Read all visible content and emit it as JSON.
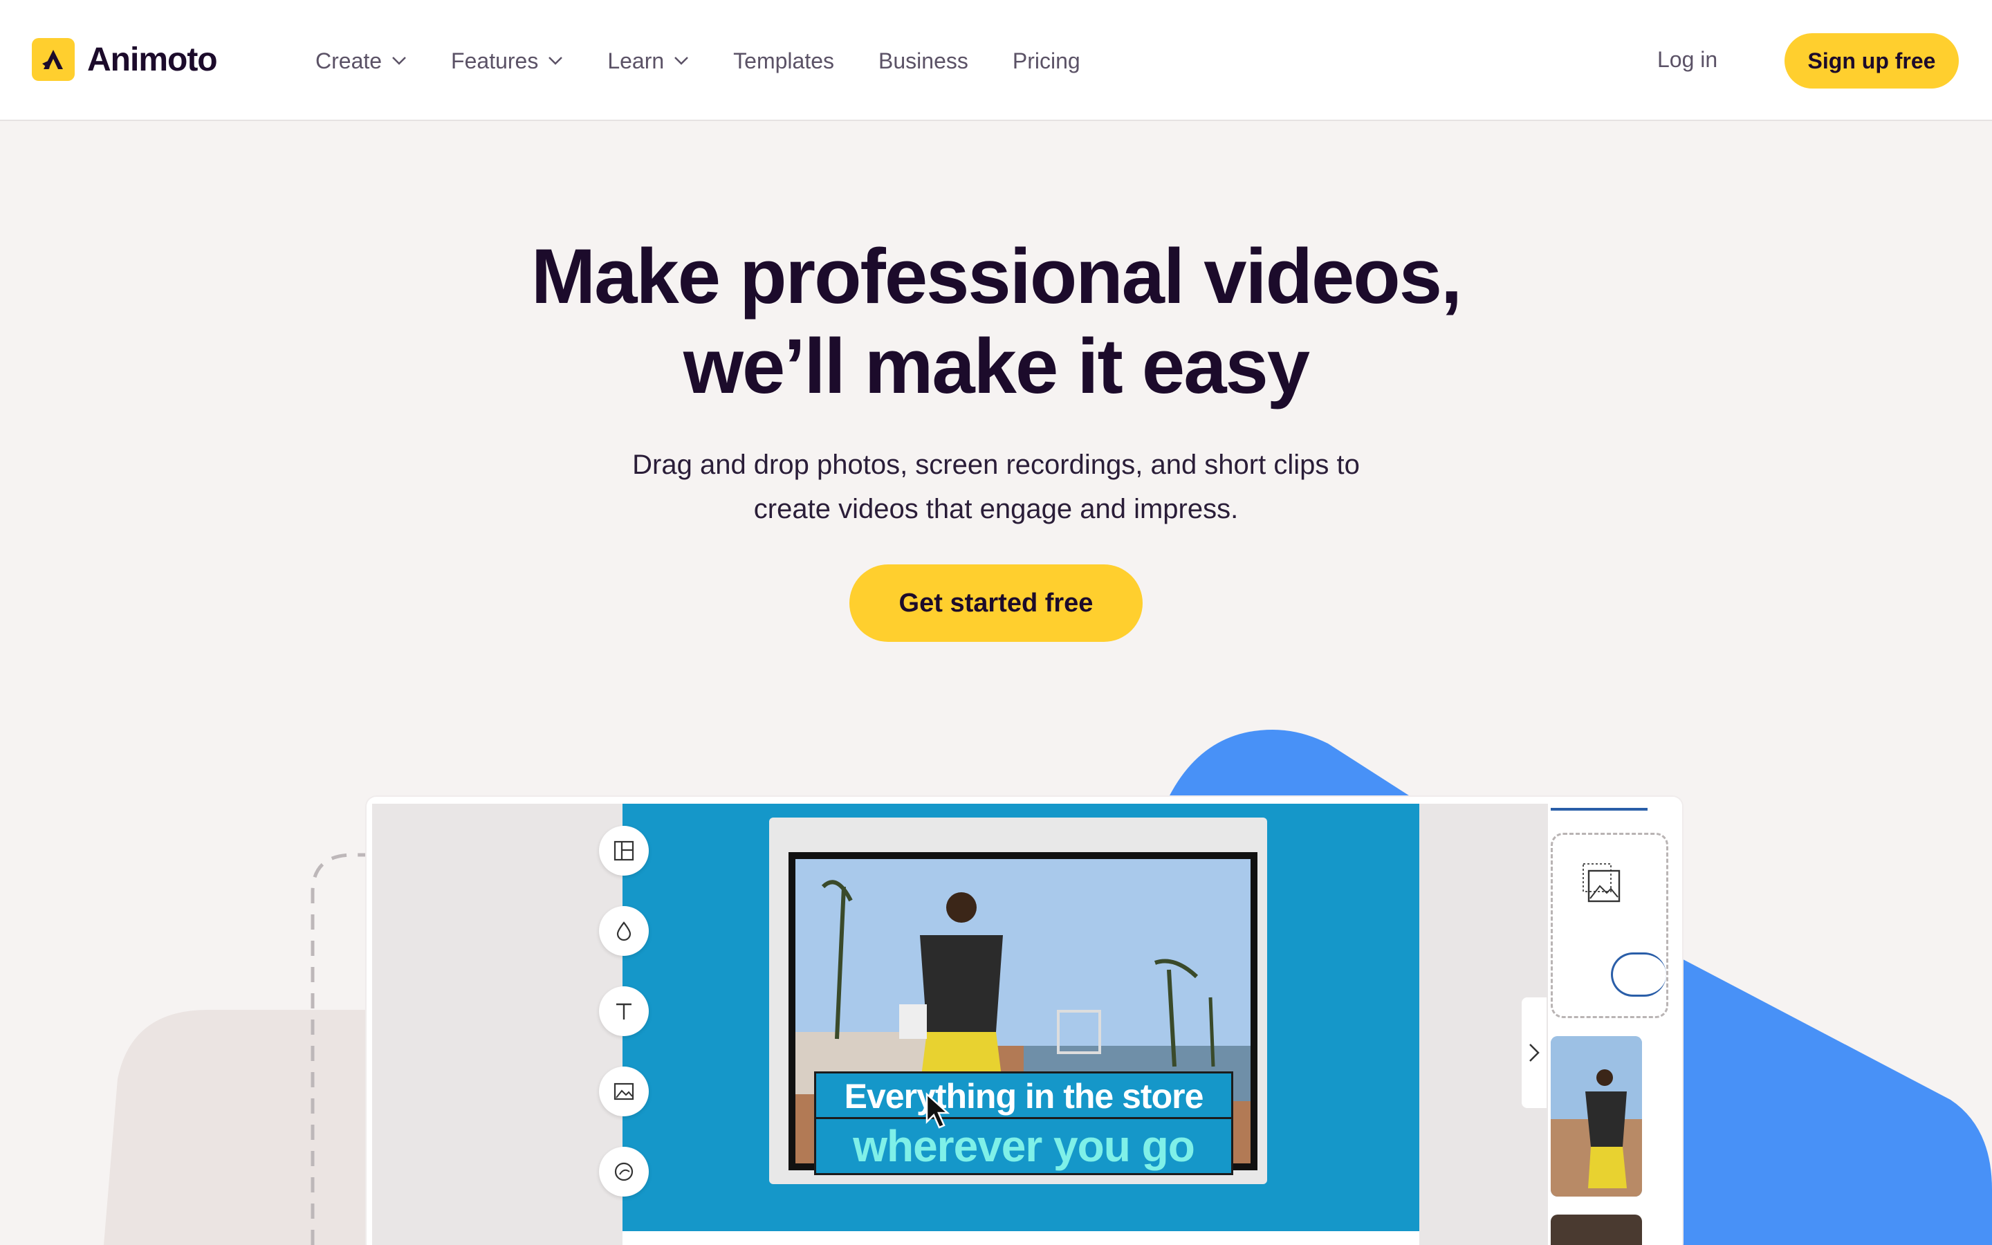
{
  "brand": {
    "name": "Animoto",
    "accent": "#ffcf2e",
    "text_color": "#1c0b2b",
    "stage_color": "#1597c9",
    "shape_color": "#4891f7"
  },
  "nav": {
    "items": [
      {
        "label": "Create",
        "has_dropdown": true
      },
      {
        "label": "Features",
        "has_dropdown": true
      },
      {
        "label": "Learn",
        "has_dropdown": true
      },
      {
        "label": "Templates",
        "has_dropdown": false
      },
      {
        "label": "Business",
        "has_dropdown": false
      },
      {
        "label": "Pricing",
        "has_dropdown": false
      }
    ],
    "login_label": "Log in",
    "signup_label": "Sign up free"
  },
  "hero": {
    "title_line1": "Make professional videos,",
    "title_line2": "we’ll make it easy",
    "subtitle_line1": "Drag and drop photos, screen recordings, and short clips to",
    "subtitle_line2": "create videos that engage and impress.",
    "cta_label": "Get started free"
  },
  "editor": {
    "tools": [
      "layout-icon",
      "color-drop-icon",
      "text-icon",
      "image-icon",
      "sticker-icon"
    ],
    "caption_line1": "Everything in the store",
    "caption_line2": "wherever you go"
  }
}
